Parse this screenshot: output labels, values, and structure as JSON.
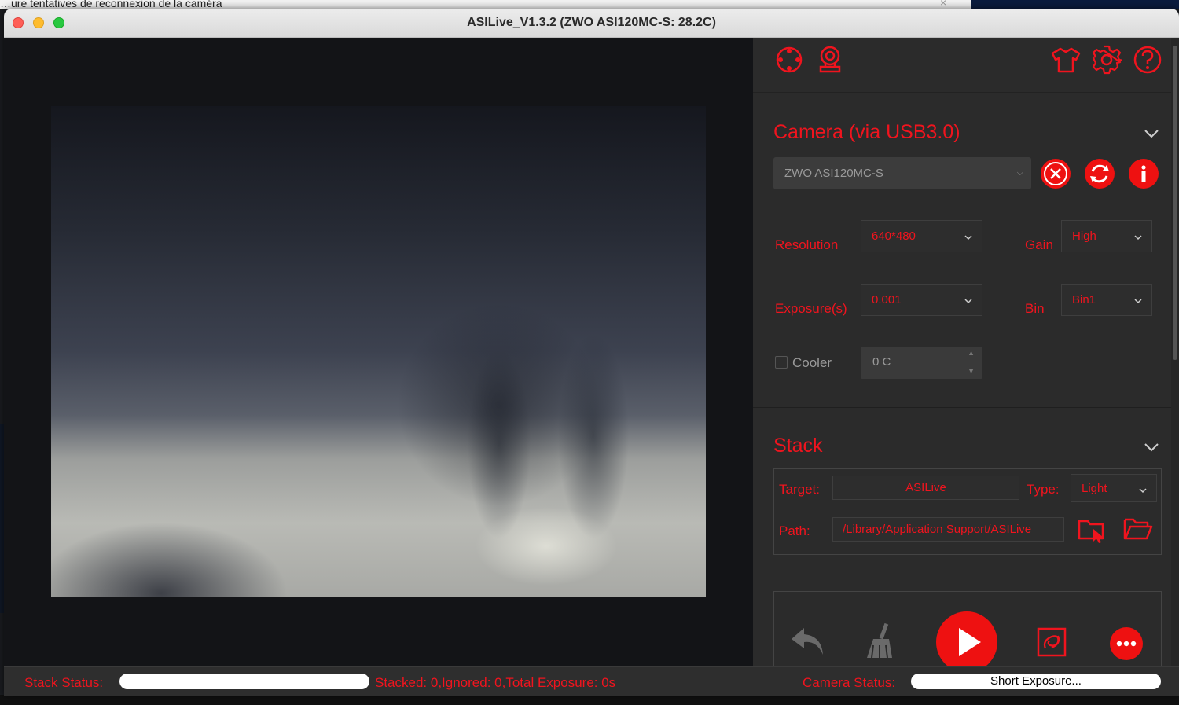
{
  "window": {
    "title": "ASILive_V1.3.2  (ZWO ASI120MC-S: 28.2C)",
    "background_text": "…ure tentatives de reconnexion de la caméra"
  },
  "toolbar": {
    "icons": [
      "target-icon",
      "webcam-icon",
      "shirt-icon",
      "gear-icon",
      "help-icon"
    ]
  },
  "camera": {
    "section_title": "Camera (via USB3.0)",
    "selected_camera": "ZWO ASI120MC-S",
    "resolution_label": "Resolution",
    "resolution_value": "640*480",
    "gain_label": "Gain",
    "gain_value": "High",
    "exposure_label": "Exposure(s)",
    "exposure_value": "0.001",
    "bin_label": "Bin",
    "bin_value": "Bin1",
    "cooler_label": "Cooler",
    "cooler_value": "0 C"
  },
  "stack": {
    "section_title": "Stack",
    "target_label": "Target:",
    "target_value": "ASILive",
    "type_label": "Type:",
    "type_value": "Light",
    "path_label": "Path:",
    "path_value": "/Library/Application Support/ASILive"
  },
  "status": {
    "stack_status_label": "Stack Status:",
    "stack_info": "Stacked: 0,Ignored: 0,Total Exposure: 0s",
    "camera_status_label": "Camera Status:",
    "camera_status_value": "Short Exposure..."
  },
  "colors": {
    "accent": "#f0141e",
    "panel": "#2b2b2b",
    "preview_bg": "#131417"
  }
}
